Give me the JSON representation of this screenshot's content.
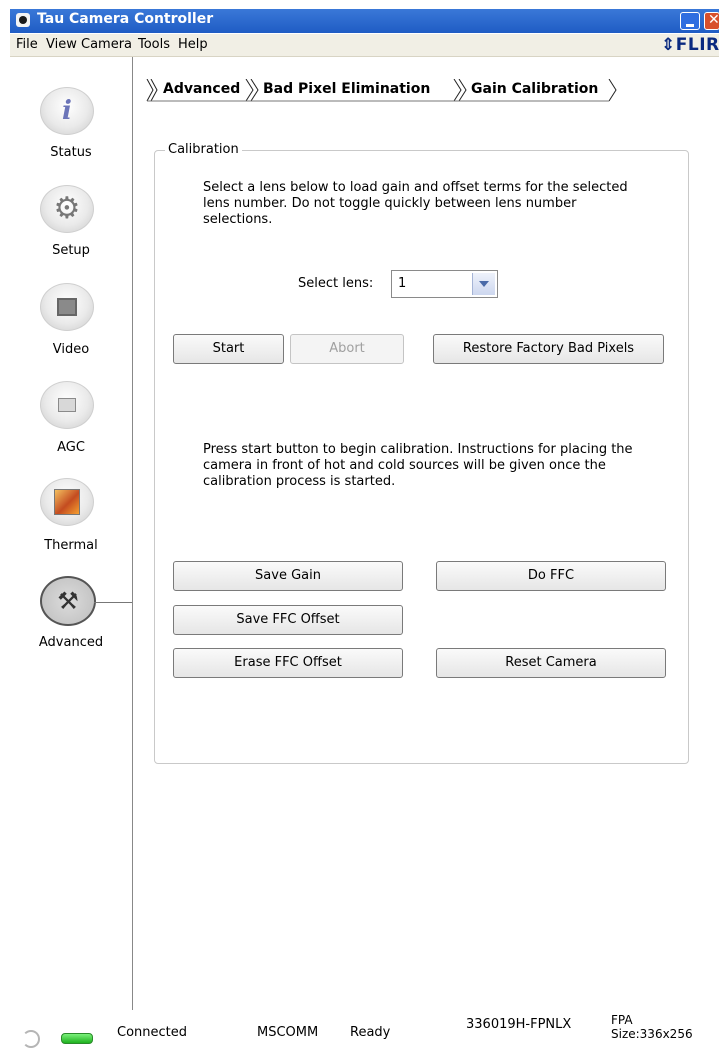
{
  "window": {
    "title": "Tau Camera Controller",
    "brand": "FLIR"
  },
  "menu": [
    "File",
    "View",
    "Camera",
    "Tools",
    "Help"
  ],
  "nav": [
    {
      "label": "Status",
      "icon": "info-icon"
    },
    {
      "label": "Setup",
      "icon": "gear-icon"
    },
    {
      "label": "Video",
      "icon": "monitor-icon"
    },
    {
      "label": "AGC",
      "icon": "agc-icon"
    },
    {
      "label": "Thermal",
      "icon": "thermal-icon"
    },
    {
      "label": "Advanced",
      "icon": "tools-icon"
    }
  ],
  "breadcrumb": [
    "Advanced",
    "Bad Pixel Elimination",
    "Gain Calibration"
  ],
  "calibration": {
    "group_label": "Calibration",
    "instructions_1": "Select a lens below to load gain and offset terms for the selected lens number. Do not toggle quickly between lens number selections.",
    "select_lens_label": "Select lens:",
    "select_lens_value": "1",
    "start": "Start",
    "abort": "Abort",
    "restore": "Restore Factory Bad Pixels",
    "instructions_2": "Press start button to begin calibration. Instructions for placing the camera in front of hot and cold sources will be given once the calibration process is started.",
    "save_gain": "Save Gain",
    "do_ffc": "Do FFC",
    "save_ffc_offset": "Save FFC Offset",
    "erase_ffc_offset": "Erase FFC Offset",
    "reset_camera": "Reset Camera"
  },
  "status": {
    "connection": "Connected",
    "port": "MSCOMM",
    "state": "Ready",
    "part_number": "336019H-FPNLX",
    "fpa_line1": "FPA",
    "fpa_line2": "Size:336x256"
  },
  "colors": {
    "titlebar": "#2a68d0",
    "led": "#2fc42f",
    "brand": "#0a2a80"
  }
}
